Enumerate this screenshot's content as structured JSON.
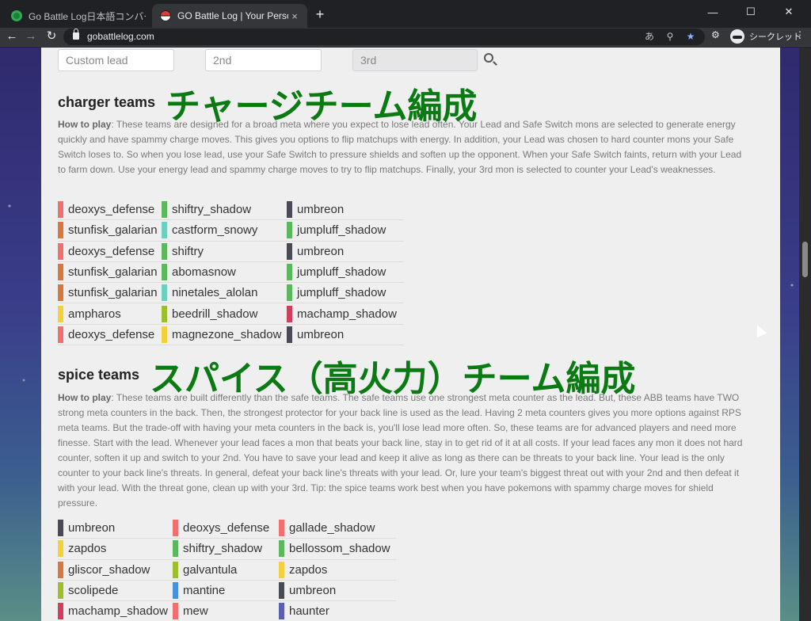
{
  "browser": {
    "tabs": [
      {
        "title": "Go Battle Log日本語コンバーター | ✕",
        "close": "×"
      },
      {
        "title": "GO Battle Log | Your Personal Bat",
        "close": "×"
      }
    ],
    "new_tab": "+",
    "url": "gobattlelog.com",
    "profile_label": "シークレット"
  },
  "search": {
    "lead_placeholder": "Custom lead",
    "second_placeholder": "2nd",
    "third_placeholder": "3rd"
  },
  "charger": {
    "heading": "charger teams",
    "overlay": "チャージチーム編成",
    "how_label": "How to play",
    "desc": ": These teams are designed for a broad meta where you expect to lose lead often. Your Lead and Safe Switch mons are selected to generate energy quickly and have spammy charge moves. This gives you options to flip matchups with energy. In addition, your Lead was chosen to hard counter mons your Safe Switch loses to. So when you lose lead, use your Safe Switch to pressure shields and soften up the opponent. When your Safe Switch faints, return with your Lead to farm down. Use your energy lead and spammy charge moves to try to flip matchups. Finally, your 3rd mon is selected to counter your Lead's weaknesses.",
    "rows": [
      [
        {
          "name": "deoxys_defense",
          "color": "#f07070"
        },
        {
          "name": "shiftry_shadow",
          "color": "#5cb85c"
        },
        {
          "name": "umbreon",
          "color": "#4a4a55"
        }
      ],
      [
        {
          "name": "stunfisk_galarian",
          "color": "#d9783c"
        },
        {
          "name": "castform_snowy",
          "color": "#6ccfc0"
        },
        {
          "name": "jumpluff_shadow",
          "color": "#5cb85c"
        }
      ],
      [
        {
          "name": "deoxys_defense",
          "color": "#f07070"
        },
        {
          "name": "shiftry",
          "color": "#5cb85c"
        },
        {
          "name": "umbreon",
          "color": "#4a4a55"
        }
      ],
      [
        {
          "name": "stunfisk_galarian",
          "color": "#d9783c"
        },
        {
          "name": "abomasnow",
          "color": "#5cb85c"
        },
        {
          "name": "jumpluff_shadow",
          "color": "#5cb85c"
        }
      ],
      [
        {
          "name": "stunfisk_galarian",
          "color": "#d9783c"
        },
        {
          "name": "ninetales_alolan",
          "color": "#6ccfc0"
        },
        {
          "name": "jumpluff_shadow",
          "color": "#5cb85c"
        }
      ],
      [
        {
          "name": "ampharos",
          "color": "#f2d13a"
        },
        {
          "name": "beedrill_shadow",
          "color": "#9cbf2b"
        },
        {
          "name": "machamp_shadow",
          "color": "#d23f5c"
        }
      ],
      [
        {
          "name": "deoxys_defense",
          "color": "#f07070"
        },
        {
          "name": "magnezone_shadow",
          "color": "#f2d13a"
        },
        {
          "name": "umbreon",
          "color": "#4a4a55"
        }
      ]
    ]
  },
  "spice": {
    "heading": "spice teams",
    "overlay": "スパイス（高火力）チーム編成",
    "how_label": "How to play",
    "desc": ": These teams are built differently than the safe teams. The safe teams use one strongest meta counter as the lead. But, these ABB teams have TWO strong meta counters in the back. Then, the strongest protector for your back line is used as the lead. Having 2 meta counters gives you more options against RPS meta teams. But the trade-off with having your meta counters in the back is, you'll lose lead more often. So, these teams are for advanced players and need more finesse. Start with the lead. Whenever your lead faces a mon that beats your back line, stay in to get rid of it at all costs. If your lead faces any mon it does not hard counter, soften it up and switch to your 2nd. You have to save your lead and keep it alive as long as there can be threats to your back line. Your lead is the only counter to your back line's threats. In general, defeat your back line's threats with your lead. Or, lure your team's biggest threat out with your 2nd and then defeat it with your lead. With the threat gone, clean up with your 3rd. Tip: the spice teams work best when you have pokemons with spammy charge moves for shield pressure.",
    "rows": [
      [
        {
          "name": "umbreon",
          "color": "#4a4a55"
        },
        {
          "name": "deoxys_defense",
          "color": "#f07070"
        },
        {
          "name": "gallade_shadow",
          "color": "#f07070"
        }
      ],
      [
        {
          "name": "zapdos",
          "color": "#f2d13a"
        },
        {
          "name": "shiftry_shadow",
          "color": "#5cb85c"
        },
        {
          "name": "bellossom_shadow",
          "color": "#5cb85c"
        }
      ],
      [
        {
          "name": "gliscor_shadow",
          "color": "#d9783c"
        },
        {
          "name": "galvantula",
          "color": "#9cbf2b"
        },
        {
          "name": "zapdos",
          "color": "#f2d13a"
        }
      ],
      [
        {
          "name": "scolipede",
          "color": "#9cbf2b"
        },
        {
          "name": "mantine",
          "color": "#4a8fe0"
        },
        {
          "name": "umbreon",
          "color": "#4a4a55"
        }
      ],
      [
        {
          "name": "machamp_shadow",
          "color": "#d23f5c"
        },
        {
          "name": "mew",
          "color": "#f07070"
        },
        {
          "name": "haunter",
          "color": "#5a5fb0"
        }
      ]
    ]
  }
}
